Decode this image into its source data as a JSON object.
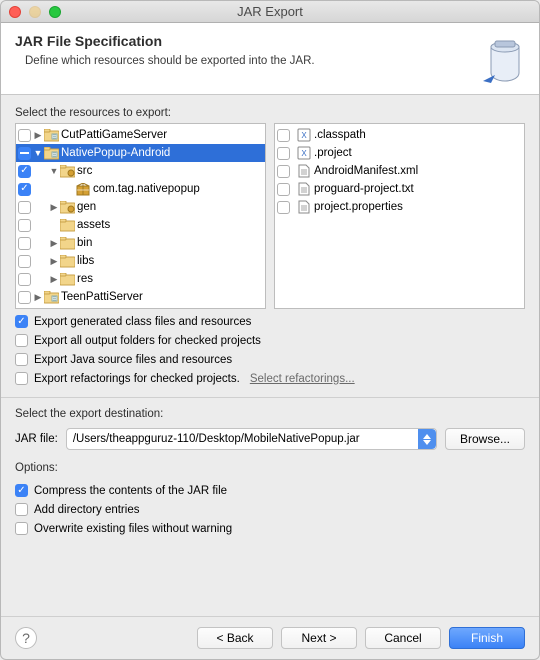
{
  "window": {
    "title": "JAR Export"
  },
  "header": {
    "title": "JAR File Specification",
    "subtitle": "Define which resources should be exported into the JAR."
  },
  "resources": {
    "label": "Select the resources to export:",
    "tree": [
      {
        "checked": false,
        "depth": 0,
        "disclosure": "closed",
        "icon": "project",
        "label": "CutPattiGameServer",
        "selected": false
      },
      {
        "checked": "minus",
        "depth": 0,
        "disclosure": "open",
        "icon": "project",
        "label": "NativePopup-Android",
        "selected": true
      },
      {
        "checked": true,
        "depth": 1,
        "disclosure": "open",
        "icon": "folder-src",
        "label": "src",
        "selected": false
      },
      {
        "checked": true,
        "depth": 2,
        "disclosure": "none",
        "icon": "package",
        "label": "com.tag.nativepopup",
        "selected": false
      },
      {
        "checked": false,
        "depth": 1,
        "disclosure": "closed",
        "icon": "folder-gen",
        "label": "gen",
        "selected": false
      },
      {
        "checked": false,
        "depth": 1,
        "disclosure": "none",
        "icon": "folder",
        "label": "assets",
        "selected": false
      },
      {
        "checked": false,
        "depth": 1,
        "disclosure": "closed",
        "icon": "folder",
        "label": "bin",
        "selected": false
      },
      {
        "checked": false,
        "depth": 1,
        "disclosure": "closed",
        "icon": "folder",
        "label": "libs",
        "selected": false
      },
      {
        "checked": false,
        "depth": 1,
        "disclosure": "closed",
        "icon": "folder",
        "label": "res",
        "selected": false
      },
      {
        "checked": false,
        "depth": 0,
        "disclosure": "closed",
        "icon": "project",
        "label": "TeenPattiServer",
        "selected": false
      }
    ],
    "files": [
      {
        "checked": false,
        "icon": "xml",
        "label": ".classpath"
      },
      {
        "checked": false,
        "icon": "xml",
        "label": ".project"
      },
      {
        "checked": false,
        "icon": "file",
        "label": "AndroidManifest.xml"
      },
      {
        "checked": false,
        "icon": "file",
        "label": "proguard-project.txt"
      },
      {
        "checked": false,
        "icon": "file",
        "label": "project.properties"
      }
    ]
  },
  "exportOptions": {
    "generated": {
      "checked": true,
      "label": "Export generated class files and resources"
    },
    "output": {
      "checked": false,
      "label": "Export all output folders for checked projects"
    },
    "source": {
      "checked": false,
      "label": "Export Java source files and resources"
    },
    "refactorings": {
      "checked": false,
      "label": "Export refactorings for checked projects.",
      "link": "Select refactorings..."
    }
  },
  "destination": {
    "label": "Select the export destination:",
    "fieldLabel": "JAR file:",
    "path": "/Users/theappguruz-110/Desktop/MobileNativePopup.jar",
    "browse": "Browse..."
  },
  "options": {
    "label": "Options:",
    "compress": {
      "checked": true,
      "label": "Compress the contents of the JAR file"
    },
    "dirEntries": {
      "checked": false,
      "label": "Add directory entries"
    },
    "overwrite": {
      "checked": false,
      "label": "Overwrite existing files without warning"
    }
  },
  "footer": {
    "back": "< Back",
    "next": "Next >",
    "cancel": "Cancel",
    "finish": "Finish"
  }
}
